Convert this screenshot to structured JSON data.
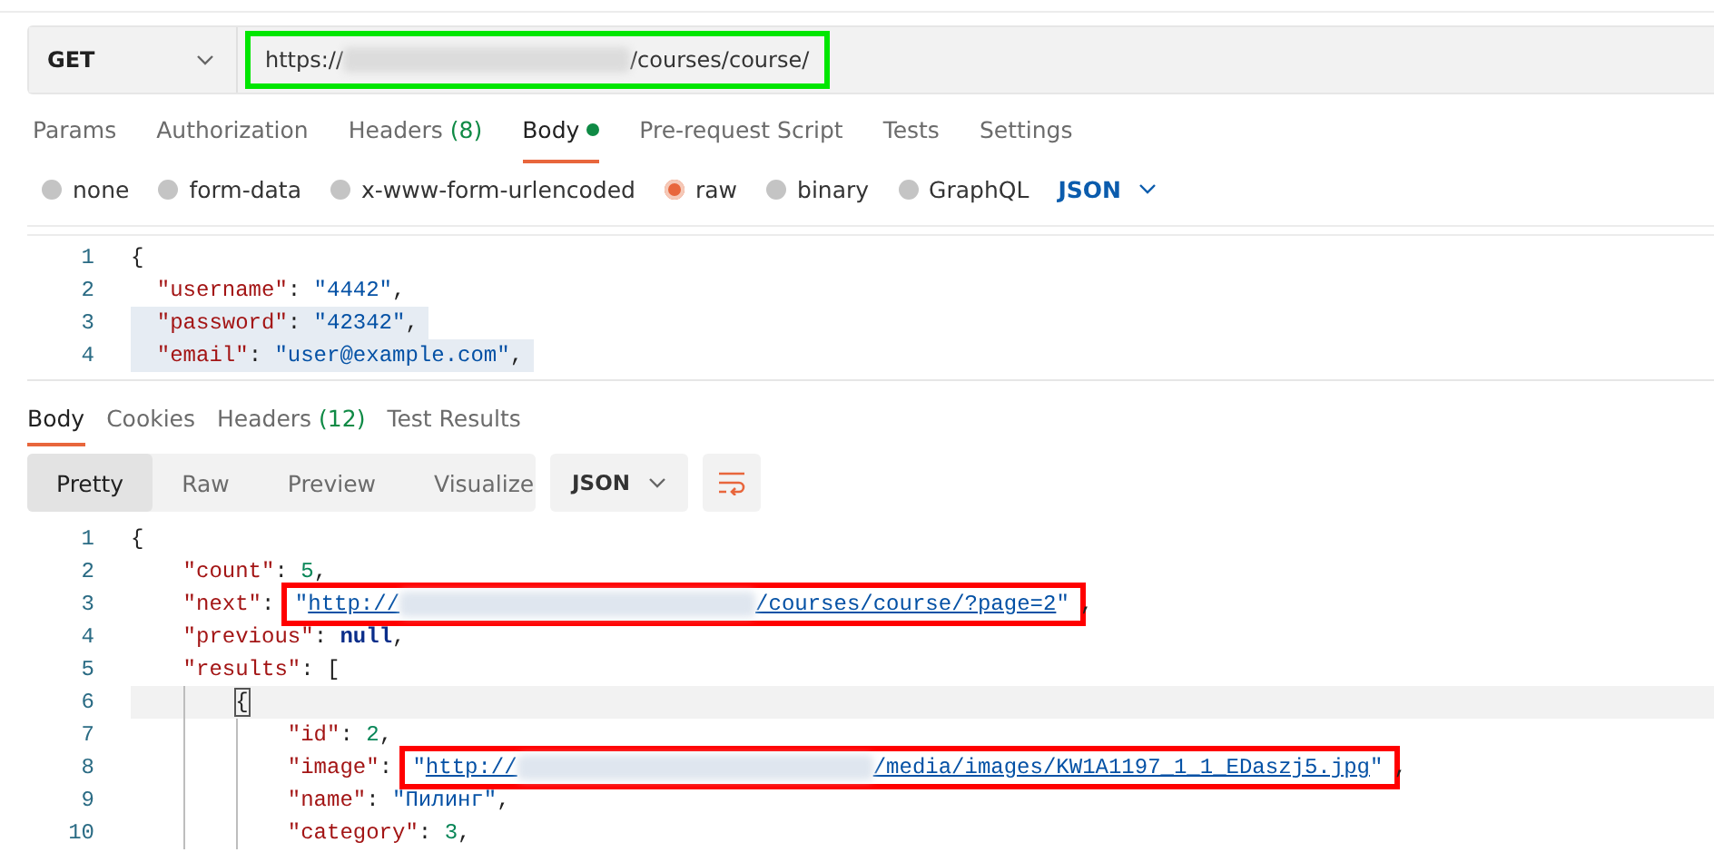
{
  "request": {
    "method": "GET",
    "url": {
      "prefix": "https://",
      "suffix": "/courses/course/",
      "color": "#00e600"
    }
  },
  "request_tabs": [
    {
      "label": "Params",
      "selected": false
    },
    {
      "label": "Authorization",
      "selected": false
    },
    {
      "label": "Headers",
      "count": "(8)",
      "selected": false
    },
    {
      "label": "Body",
      "indicator": true,
      "selected": true
    },
    {
      "label": "Pre-request Script",
      "selected": false
    },
    {
      "label": "Tests",
      "selected": false
    },
    {
      "label": "Settings",
      "selected": false
    }
  ],
  "body_types": [
    {
      "label": "none",
      "selected": false
    },
    {
      "label": "form-data",
      "selected": false
    },
    {
      "label": "x-www-form-urlencoded",
      "selected": false
    },
    {
      "label": "raw",
      "selected": true
    },
    {
      "label": "binary",
      "selected": false
    },
    {
      "label": "GraphQL",
      "selected": false
    }
  ],
  "body_format": "JSON",
  "request_body": [
    {
      "number": "1",
      "selected": false,
      "tokens": [
        {
          "kind": "punct",
          "text": "{"
        }
      ]
    },
    {
      "number": "2",
      "selected": false,
      "tokens": [
        {
          "kind": "pad"
        },
        {
          "kind": "key",
          "text": "\"username\""
        },
        {
          "kind": "punct",
          "text": ":"
        },
        {
          "kind": "space"
        },
        {
          "kind": "string",
          "text": "\"4442\""
        },
        {
          "kind": "punct",
          "text": ","
        }
      ]
    },
    {
      "number": "3",
      "selected": true,
      "tokens": [
        {
          "kind": "pad"
        },
        {
          "kind": "key",
          "text": "\"password\""
        },
        {
          "kind": "punct",
          "text": ":"
        },
        {
          "kind": "space"
        },
        {
          "kind": "string",
          "text": "\"42342\""
        },
        {
          "kind": "punct",
          "text": ","
        }
      ]
    },
    {
      "number": "4",
      "selected": true,
      "tokens": [
        {
          "kind": "pad"
        },
        {
          "kind": "key",
          "text": "\"email\""
        },
        {
          "kind": "punct",
          "text": ":"
        },
        {
          "kind": "space"
        },
        {
          "kind": "string",
          "text": "\"user@example.com\""
        },
        {
          "kind": "punct",
          "text": ","
        }
      ]
    }
  ],
  "response_tabs": [
    {
      "label": "Body",
      "selected": true
    },
    {
      "label": "Cookies",
      "selected": false
    },
    {
      "label": "Headers",
      "count": "(12)",
      "selected": false
    },
    {
      "label": "Test Results",
      "selected": false
    }
  ],
  "view_modes": [
    {
      "label": "Pretty",
      "selected": true
    },
    {
      "label": "Raw",
      "selected": false
    },
    {
      "label": "Preview",
      "selected": false
    },
    {
      "label": "Visualize",
      "selected": false
    }
  ],
  "response_format": "JSON",
  "response_body": [
    {
      "number": "1",
      "current": false,
      "tokens": [
        {
          "kind": "punct",
          "text": "{"
        }
      ]
    },
    {
      "number": "2",
      "current": false,
      "tokens": [
        {
          "kind": "indent"
        },
        {
          "kind": "key",
          "text": "\"count\""
        },
        {
          "kind": "punct",
          "text": ": "
        },
        {
          "kind": "number",
          "text": "5"
        },
        {
          "kind": "punct",
          "text": ","
        }
      ]
    },
    {
      "number": "3",
      "current": false,
      "tokens": [
        {
          "kind": "indent"
        },
        {
          "kind": "key",
          "text": "\"next\""
        },
        {
          "kind": "punct",
          "text": ": "
        },
        {
          "kind": "highlight",
          "color": "#ff0000",
          "tokens": [
            {
              "kind": "string",
              "text": "\""
            },
            {
              "kind": "link",
              "prefix": "http://",
              "suffix": "/courses/course/?page=2"
            },
            {
              "kind": "string",
              "text": "\""
            }
          ]
        },
        {
          "kind": "punct",
          "text": ","
        }
      ]
    },
    {
      "number": "4",
      "current": false,
      "tokens": [
        {
          "kind": "indent"
        },
        {
          "kind": "key",
          "text": "\"previous\""
        },
        {
          "kind": "punct",
          "text": ": "
        },
        {
          "kind": "null",
          "text": "null"
        },
        {
          "kind": "punct",
          "text": ","
        }
      ]
    },
    {
      "number": "5",
      "current": false,
      "tokens": [
        {
          "kind": "indent"
        },
        {
          "kind": "key",
          "text": "\"results\""
        },
        {
          "kind": "punct",
          "text": ": ["
        }
      ]
    },
    {
      "number": "6",
      "current": true,
      "tokens": [
        {
          "kind": "indent"
        },
        {
          "kind": "guide"
        },
        {
          "kind": "bracket",
          "text": "{"
        }
      ]
    },
    {
      "number": "7",
      "current": false,
      "tokens": [
        {
          "kind": "indent"
        },
        {
          "kind": "guide"
        },
        {
          "kind": "guide"
        },
        {
          "kind": "key",
          "text": "\"id\""
        },
        {
          "kind": "punct",
          "text": ": "
        },
        {
          "kind": "number",
          "text": "2"
        },
        {
          "kind": "punct",
          "text": ","
        }
      ]
    },
    {
      "number": "8",
      "current": false,
      "tokens": [
        {
          "kind": "indent"
        },
        {
          "kind": "guide"
        },
        {
          "kind": "guide"
        },
        {
          "kind": "key",
          "text": "\"image\""
        },
        {
          "kind": "punct",
          "text": ": "
        },
        {
          "kind": "highlight",
          "color": "#ff0000",
          "tokens": [
            {
              "kind": "string",
              "text": "\""
            },
            {
              "kind": "link",
              "prefix": "http://",
              "suffix": "/media/images/KW1A1197_1_1_EDaszj5.jpg"
            },
            {
              "kind": "string",
              "text": "\""
            }
          ]
        },
        {
          "kind": "punct",
          "text": ","
        }
      ]
    },
    {
      "number": "9",
      "current": false,
      "tokens": [
        {
          "kind": "indent"
        },
        {
          "kind": "guide"
        },
        {
          "kind": "guide"
        },
        {
          "kind": "key",
          "text": "\"name\""
        },
        {
          "kind": "punct",
          "text": ": "
        },
        {
          "kind": "string",
          "text": "\"Пилинг\""
        },
        {
          "kind": "punct",
          "text": ","
        }
      ]
    },
    {
      "number": "10",
      "current": false,
      "tokens": [
        {
          "kind": "indent"
        },
        {
          "kind": "guide"
        },
        {
          "kind": "guide"
        },
        {
          "kind": "key",
          "text": "\"category\""
        },
        {
          "kind": "punct",
          "text": ": "
        },
        {
          "kind": "number",
          "text": "3"
        },
        {
          "kind": "punct",
          "text": ","
        }
      ]
    }
  ]
}
